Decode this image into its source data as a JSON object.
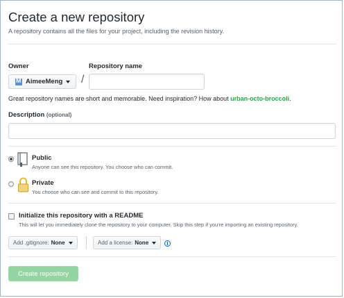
{
  "header": {
    "title": "Create a new repository",
    "subtitle": "A repository contains all the files for your project, including the revision history."
  },
  "owner": {
    "label": "Owner",
    "value": "AimeeMeng",
    "separator": "/"
  },
  "repo_name": {
    "label": "Repository name",
    "value": ""
  },
  "hint": {
    "text": "Great repository names are short and memorable. Need inspiration? How about ",
    "suggestion": "urban-octo-broccoli",
    "end": "."
  },
  "description": {
    "label": "Description",
    "optional": "(optional)",
    "value": ""
  },
  "visibility": {
    "public": {
      "name": "Public",
      "desc": "Anyone can see this repository. You choose who can commit.",
      "selected": true
    },
    "private": {
      "name": "Private",
      "desc": "You choose who can see and commit to this repository.",
      "selected": false
    }
  },
  "init": {
    "label": "Initialize this repository with a README",
    "desc": "This will let you immediately clone the repository to your computer. Skip this step if you're importing an existing repository.",
    "checked": false
  },
  "gitignore": {
    "label": "Add .gitignore:",
    "value": "None"
  },
  "license": {
    "label": "Add a license:",
    "value": "None"
  },
  "submit": {
    "label": "Create repository"
  },
  "colors": {
    "accent_green": "#28a745",
    "button_disabled": "#94d3a2",
    "link_blue": "#0366d6"
  }
}
